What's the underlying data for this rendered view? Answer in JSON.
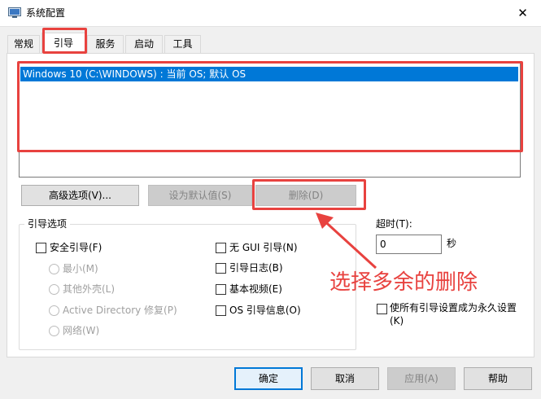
{
  "window": {
    "title": "系统配置",
    "close_glyph": "✕"
  },
  "tabs": [
    {
      "label": "常规"
    },
    {
      "label": "引导"
    },
    {
      "label": "服务"
    },
    {
      "label": "启动"
    },
    {
      "label": "工具"
    }
  ],
  "os_list": {
    "items": [
      "Windows 10 (C:\\WINDOWS) : 当前 OS; 默认 OS"
    ]
  },
  "buttons": {
    "advanced": "高级选项(V)...",
    "set_default": "设为默认值(S)",
    "delete": "删除(D)"
  },
  "boot_options": {
    "label": "引导选项",
    "safe_boot": "安全引导(F)",
    "minimal": "最小(M)",
    "alternate_shell": "其他外壳(L)",
    "ad_repair": "Active Directory 修复(P)",
    "network": "网络(W)",
    "no_gui": "无 GUI 引导(N)",
    "boot_log": "引导日志(B)",
    "base_video": "基本视频(E)",
    "os_boot_info": "OS 引导信息(O)"
  },
  "timeout": {
    "label": "超时(T):",
    "value": "0",
    "unit": "秒"
  },
  "permanent": {
    "line1": "使所有引导设置成为永久设置",
    "line2": "(K)"
  },
  "annotation": {
    "text": "选择多余的删除",
    "color": "#e8423f"
  },
  "footer": {
    "ok": "确定",
    "cancel": "取消",
    "apply": "应用(A)",
    "help": "帮助"
  },
  "colors": {
    "selection": "#0078d7",
    "accent_red": "#e8423f"
  }
}
